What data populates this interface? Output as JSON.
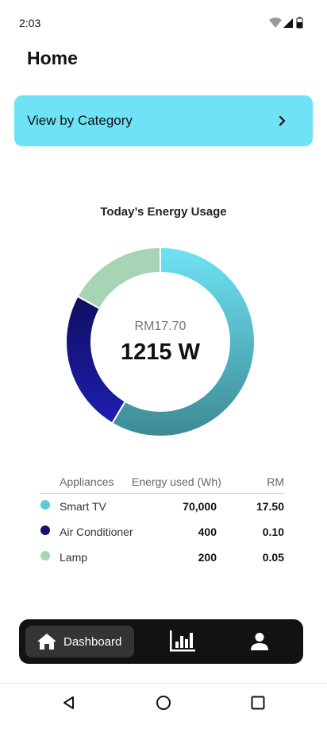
{
  "status_bar": {
    "time": "2:03",
    "icons": [
      "wifi-icon",
      "cellular-signal-icon",
      "battery-icon"
    ]
  },
  "header": {
    "title": "Home"
  },
  "category_button": {
    "label": "View by Category",
    "icon": "chevron-right-icon",
    "color": "#6fe3f5"
  },
  "chart_data": {
    "type": "pie",
    "title": "Today’s Energy Usage",
    "center_cost": "RM17.70",
    "center_power": "1215 W",
    "slices": [
      {
        "label": "Smart TV",
        "value": 58.5,
        "color_start": "#6fe3f5",
        "color_end": "#3c8a93"
      },
      {
        "label": "Air Conditioner",
        "value": 24.5,
        "color_start": "#0f0f60",
        "color_end": "#1e1eb0"
      },
      {
        "label": "Lamp",
        "value": 17,
        "color_start": "#a6d4b4",
        "color_end": "#a6d4b4"
      }
    ]
  },
  "table": {
    "headers": {
      "appliances": "Appliances",
      "energy": "Energy used (Wh)",
      "rm": "RM"
    },
    "rows": [
      {
        "name": "Smart TV",
        "energy": "70,000",
        "rm": "17.50",
        "color": "#5fc9dc"
      },
      {
        "name": "Air Conditioner",
        "energy": "400",
        "rm": "0.10",
        "color": "#13136e"
      },
      {
        "name": "Lamp",
        "energy": "200",
        "rm": "0.05",
        "color": "#a6d4b4"
      }
    ]
  },
  "bottom_nav": {
    "items": [
      {
        "label": "Dashboard",
        "icon": "home-icon",
        "active": true
      },
      {
        "label": "",
        "icon": "bar-chart-icon",
        "active": false
      },
      {
        "label": "",
        "icon": "person-icon",
        "active": false
      }
    ]
  },
  "system_nav": [
    "back-icon",
    "home-circle-icon",
    "recents-icon"
  ]
}
